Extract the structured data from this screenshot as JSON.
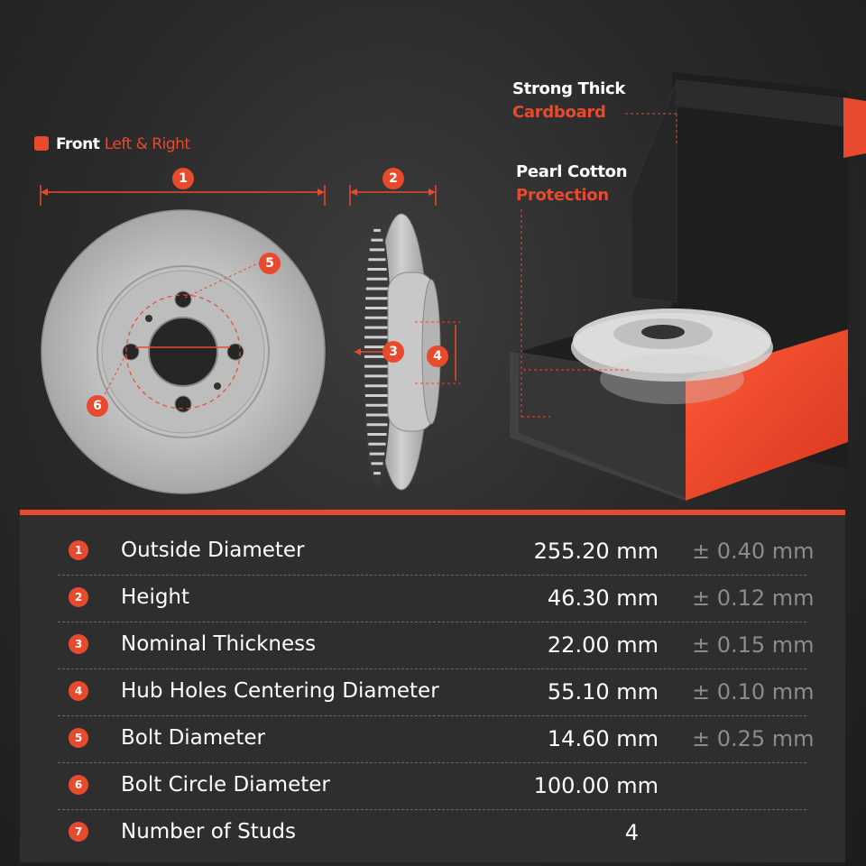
{
  "front_label": {
    "main": "Front",
    "sub": "Left & Right"
  },
  "badges": [
    "1",
    "2",
    "3",
    "4",
    "5",
    "6"
  ],
  "callouts": {
    "cardboard": {
      "line1": "Strong Thick",
      "line2": "Cardboard"
    },
    "cotton": {
      "line1": "Pearl Cotton",
      "line2": "Protection"
    }
  },
  "specs": [
    {
      "num": "1",
      "name": "Outside Diameter",
      "value": "255.20 mm",
      "tolerance": "± 0.40 mm"
    },
    {
      "num": "2",
      "name": "Height",
      "value": "46.30 mm",
      "tolerance": "± 0.12 mm"
    },
    {
      "num": "3",
      "name": "Nominal Thickness",
      "value": "22.00 mm",
      "tolerance": "± 0.15 mm"
    },
    {
      "num": "4",
      "name": "Hub Holes Centering Diameter",
      "value": "55.10 mm",
      "tolerance": "± 0.10 mm"
    },
    {
      "num": "5",
      "name": "Bolt Diameter",
      "value": "14.60 mm",
      "tolerance": "± 0.25 mm"
    },
    {
      "num": "6",
      "name": "Bolt Circle Diameter",
      "value": "100.00 mm",
      "tolerance": ""
    },
    {
      "num": "7",
      "name": "Number of Studs",
      "value": "4",
      "tolerance": ""
    }
  ],
  "colors": {
    "accent": "#e84a2e",
    "panel": "#2e2e2e",
    "rotor": "#b8b8b8"
  }
}
